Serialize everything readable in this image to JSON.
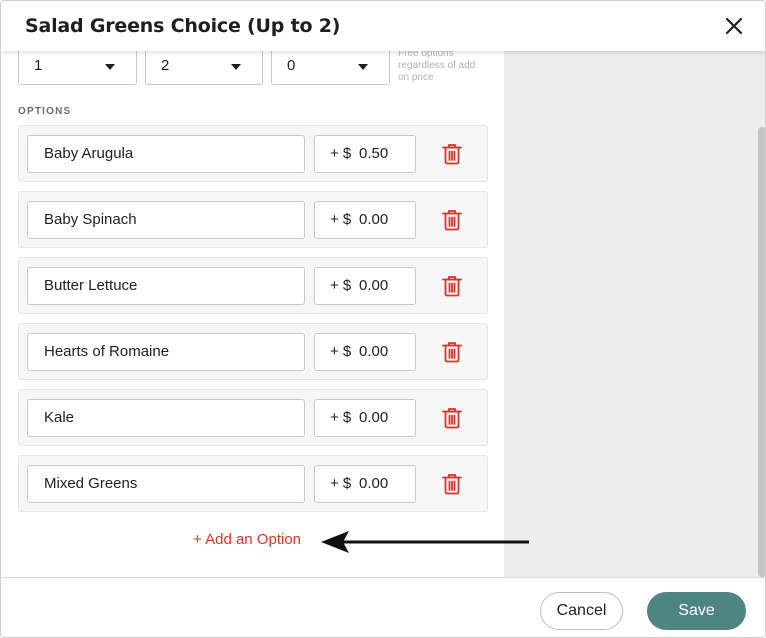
{
  "modal": {
    "title": "Salad Greens Choice (Up to 2)"
  },
  "selects": [
    {
      "value": "1"
    },
    {
      "value": "2"
    },
    {
      "value": "0"
    }
  ],
  "free_options_hint": "Free options regardless of add on price",
  "options_label": "OPTIONS",
  "options": [
    {
      "name": "Baby Arugula",
      "price_prefix": "+ $",
      "price": "0.50"
    },
    {
      "name": "Baby Spinach",
      "price_prefix": "+ $",
      "price": "0.00"
    },
    {
      "name": "Butter Lettuce",
      "price_prefix": "+ $",
      "price": "0.00"
    },
    {
      "name": "Hearts of Romaine",
      "price_prefix": "+ $",
      "price": "0.00"
    },
    {
      "name": "Kale",
      "price_prefix": "+ $",
      "price": "0.00"
    },
    {
      "name": "Mixed Greens",
      "price_prefix": "+ $",
      "price": "0.00"
    }
  ],
  "add_option_label": "+ Add an Option",
  "footer": {
    "cancel_label": "Cancel",
    "save_label": "Save"
  },
  "colors": {
    "accent_red": "#d9342b",
    "save_button": "#4e8482",
    "side_panel": "#ededed"
  },
  "icons": {
    "close": "close-icon",
    "delete": "trash-icon",
    "dropdown": "chevron-down-icon",
    "annotation": "arrow-left-icon"
  }
}
